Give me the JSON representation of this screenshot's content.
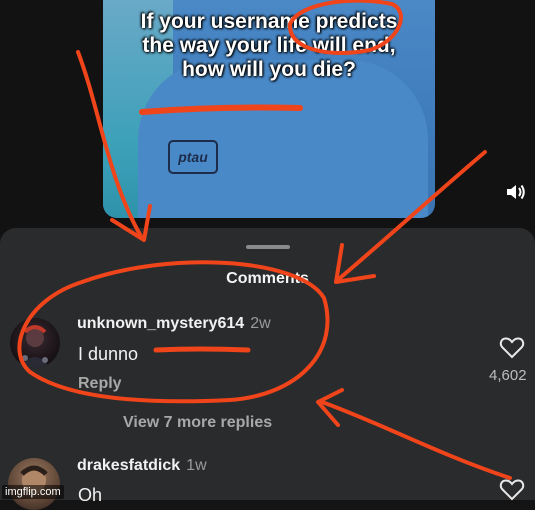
{
  "video": {
    "caption_line1": "If your username predicts",
    "caption_line2": "the way your life will end,",
    "caption_line3": "how will you die?",
    "logo_text": "ptau"
  },
  "sheet": {
    "title": "Comments"
  },
  "comments": [
    {
      "username": "unknown_mystery614",
      "time": "2w",
      "text": "I dunno",
      "reply_label": "Reply",
      "likes": "4,602",
      "more_replies": "View 7 more replies"
    },
    {
      "username": "drakesfatdick",
      "time": "1w",
      "text": "Oh"
    }
  ],
  "watermark": "imgflip.com",
  "colors": {
    "sheet_bg": "#2a2b2d",
    "annotation": "#f0441a",
    "video_blue": "#4a89c7"
  },
  "icons": [
    "sound-icon",
    "heart-icon"
  ]
}
